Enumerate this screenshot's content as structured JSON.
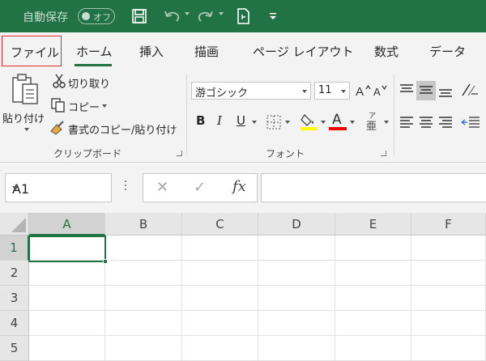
{
  "titlebar": {
    "autosave_label": "自動保存",
    "autosave_state": "オフ",
    "bg_color": "#217346",
    "icons": [
      "save-icon",
      "undo-icon",
      "redo-icon",
      "touch-mode-icon",
      "customize-toolbar-icon"
    ]
  },
  "tabs": [
    {
      "label": "ファイル",
      "highlighted": true
    },
    {
      "label": "ホーム",
      "selected": true
    },
    {
      "label": "挿入"
    },
    {
      "label": "描画"
    },
    {
      "label": "ページ レイアウト"
    },
    {
      "label": "数式"
    },
    {
      "label": "データ"
    }
  ],
  "ribbon": {
    "clipboard": {
      "paste": "貼り付け",
      "cut": "切り取り",
      "copy": "コピー",
      "format_painter": "書式のコピー/貼り付け",
      "group_label": "クリップボード"
    },
    "font": {
      "font_name": "游ゴシック",
      "font_size": "11",
      "bold": "B",
      "italic": "I",
      "underline": "U",
      "font_color_letter": "A",
      "phonetic_letter": "亜",
      "phonetic_ruby": "ア",
      "group_label": "フォント",
      "highlight_color": "#ffff00",
      "font_color": "#ff0000"
    }
  },
  "formula_bar": {
    "name_box": "A1",
    "cancel": "✕",
    "enter": "✓",
    "fx": "fx",
    "value": ""
  },
  "grid": {
    "columns": [
      "A",
      "B",
      "C",
      "D",
      "E",
      "F"
    ],
    "rows": [
      "1",
      "2",
      "3",
      "4",
      "5"
    ],
    "selected_cell": "A1"
  }
}
